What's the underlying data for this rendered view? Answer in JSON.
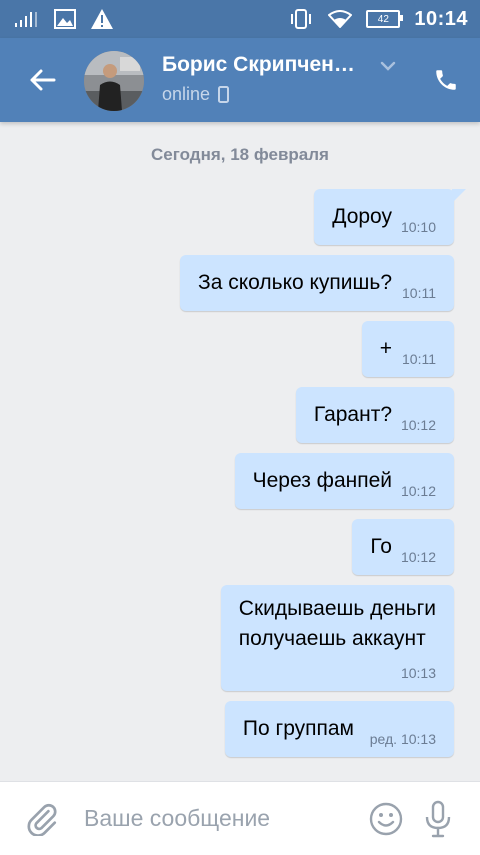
{
  "status_bar": {
    "time": "10:14",
    "battery": "42"
  },
  "header": {
    "name": "Борис Скрипчен…",
    "status": "online"
  },
  "chat": {
    "date": "Сегодня, 18 февраля",
    "messages": [
      {
        "text": "Дороу",
        "time": "10:10"
      },
      {
        "text": "За сколько купишь?",
        "time": "10:11"
      },
      {
        "text": "+",
        "time": "10:11"
      },
      {
        "text": "Гарант?",
        "time": "10:12"
      },
      {
        "text": "Через фанпей",
        "time": "10:12"
      },
      {
        "text": "Го",
        "time": "10:12"
      },
      {
        "text": "Скидываешь деньги\nполучаешь аккаунт",
        "time": "10:13"
      },
      {
        "text": "По группам",
        "time": "ред. 10:13"
      }
    ]
  },
  "composer": {
    "placeholder": "Ваше сообщение"
  },
  "colors": {
    "header": "#5181b8",
    "bubble": "#cce4ff",
    "background": "#edeef0"
  }
}
